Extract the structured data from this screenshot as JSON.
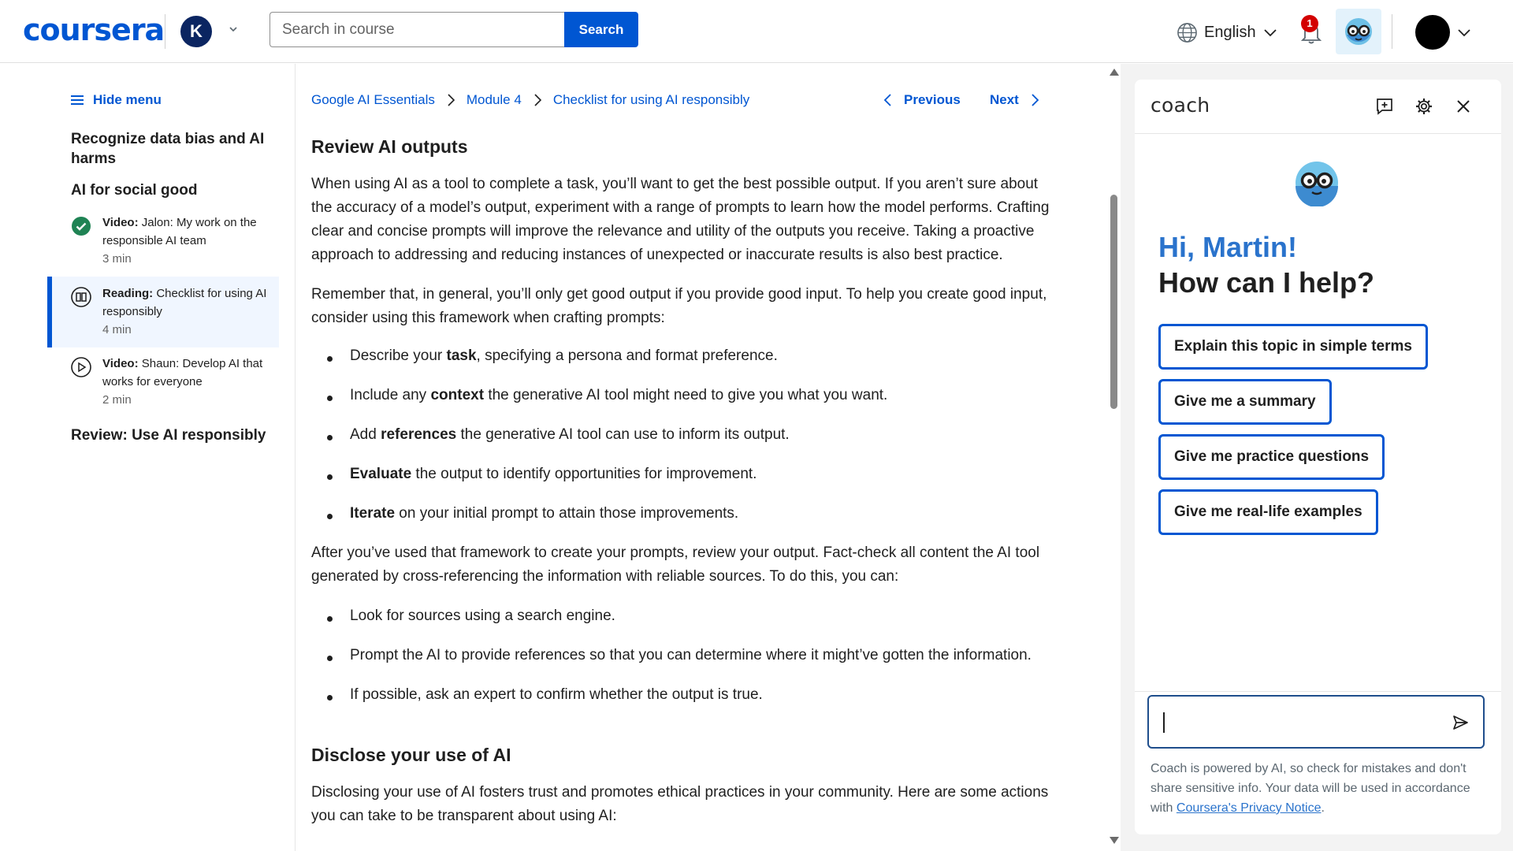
{
  "header": {
    "logo": "coursera",
    "account_initial": "K",
    "search_placeholder": "Search in course",
    "search_button": "Search",
    "language": "English",
    "notification_count": "1"
  },
  "sidebar": {
    "hide_menu": "Hide menu",
    "section_1": "Recognize data bias and AI harms",
    "section_2": "AI for social good",
    "lessons": [
      {
        "type": "Video:",
        "title": "Jalon: My work on the responsible AI team",
        "duration": "3 min",
        "status": "completed"
      },
      {
        "type": "Reading:",
        "title": "Checklist for using AI responsibly",
        "duration": "4 min",
        "status": "active"
      },
      {
        "type": "Video:",
        "title": "Shaun: Develop AI that works for everyone",
        "duration": "2 min",
        "status": "video"
      }
    ],
    "section_3": "Review: Use AI responsibly"
  },
  "breadcrumb": {
    "items": [
      "Google AI Essentials",
      "Module 4",
      "Checklist for using AI responsibly"
    ],
    "previous": "Previous",
    "next": "Next"
  },
  "content": {
    "heading_1": "Review AI outputs",
    "para_1": "When using AI as a tool to complete a task, you’ll want to get the best possible output. If you aren’t sure about the accuracy of a model’s output, experiment with a range of prompts to learn how the model performs. Crafting clear and concise prompts will improve the relevance and utility of the outputs you receive. Taking a proactive approach to addressing and reducing instances of unexpected or inaccurate results is also best practice.",
    "para_2": "Remember that, in general, you’ll only get good output if you provide good input. To help you create good input, consider using this framework when crafting prompts:",
    "list_1": [
      {
        "pre": "Describe your ",
        "bold": "task",
        "post": ", specifying a persona and format preference."
      },
      {
        "pre": "Include any ",
        "bold": "context",
        "post": " the generative AI tool might need to give you what you want."
      },
      {
        "pre": "Add ",
        "bold": "references",
        "post": " the generative AI tool can use to inform its output."
      },
      {
        "pre": "",
        "bold": "Evaluate",
        "post": " the output to identify opportunities for improvement."
      },
      {
        "pre": "",
        "bold": "Iterate",
        "post": " on your initial prompt to attain those improvements."
      }
    ],
    "para_3": "After you’ve used that framework to create your prompts, review your output. Fact-check all content the AI tool generated by cross-referencing the information with reliable sources. To do this, you can:",
    "list_2": [
      "Look for sources using a search engine.",
      "Prompt the AI to provide references so that you can determine where it might’ve gotten the information.",
      "If possible, ask an expert to confirm whether the output is true."
    ],
    "heading_2": "Disclose your use of AI",
    "para_4": "Disclosing your use of AI fosters trust and promotes ethical practices in your community. Here are some actions you can take to be transparent about using AI:"
  },
  "coach": {
    "title": "coach",
    "greeting": "Hi, Martin!",
    "question": "How can I help?",
    "suggestions": [
      "Explain this topic in simple terms",
      "Give me a summary",
      "Give me practice questions",
      "Give me real-life examples"
    ],
    "input_placeholder": "",
    "disclaimer_text": "Coach is powered by AI, so check for mistakes and don't share sensitive info. Your data will be used in accordance with ",
    "privacy_link": "Coursera's Privacy Notice",
    "disclaimer_end": "."
  },
  "colors": {
    "brand_blue": "#0056d2",
    "greeting_blue": "#2a73cc",
    "completed_green": "#1f8354",
    "notification_red": "#d30001"
  },
  "icons": [
    "globe-icon",
    "chevron-down-icon",
    "bell-icon",
    "coach-mascot-icon",
    "menu-icon",
    "checkmark-circle-icon",
    "reading-icon",
    "play-circle-icon",
    "chevron-right-icon",
    "chevron-left-icon",
    "new-chat-icon",
    "gear-icon",
    "close-icon",
    "send-icon"
  ]
}
